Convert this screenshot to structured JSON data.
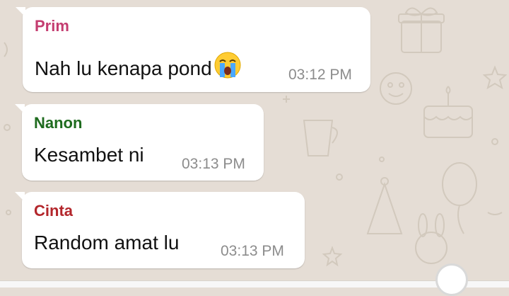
{
  "colors": {
    "wallpaper": "#e5ddd5",
    "bubble": "#ffffff",
    "timestamp": "#8c8c8c"
  },
  "messages": [
    {
      "sender": "Prim",
      "sender_color": "#c43d70",
      "text": "Nah lu kenapa pond",
      "emoji": "loudly-crying-face-emoji",
      "time": "03:12 PM"
    },
    {
      "sender": "Nanon",
      "sender_color": "#1e6b1e",
      "text": "Kesambet ni",
      "time": "03:13 PM"
    },
    {
      "sender": "Cinta",
      "sender_color": "#b3262b",
      "text": "Random amat lu",
      "time": "03:13 PM"
    }
  ]
}
